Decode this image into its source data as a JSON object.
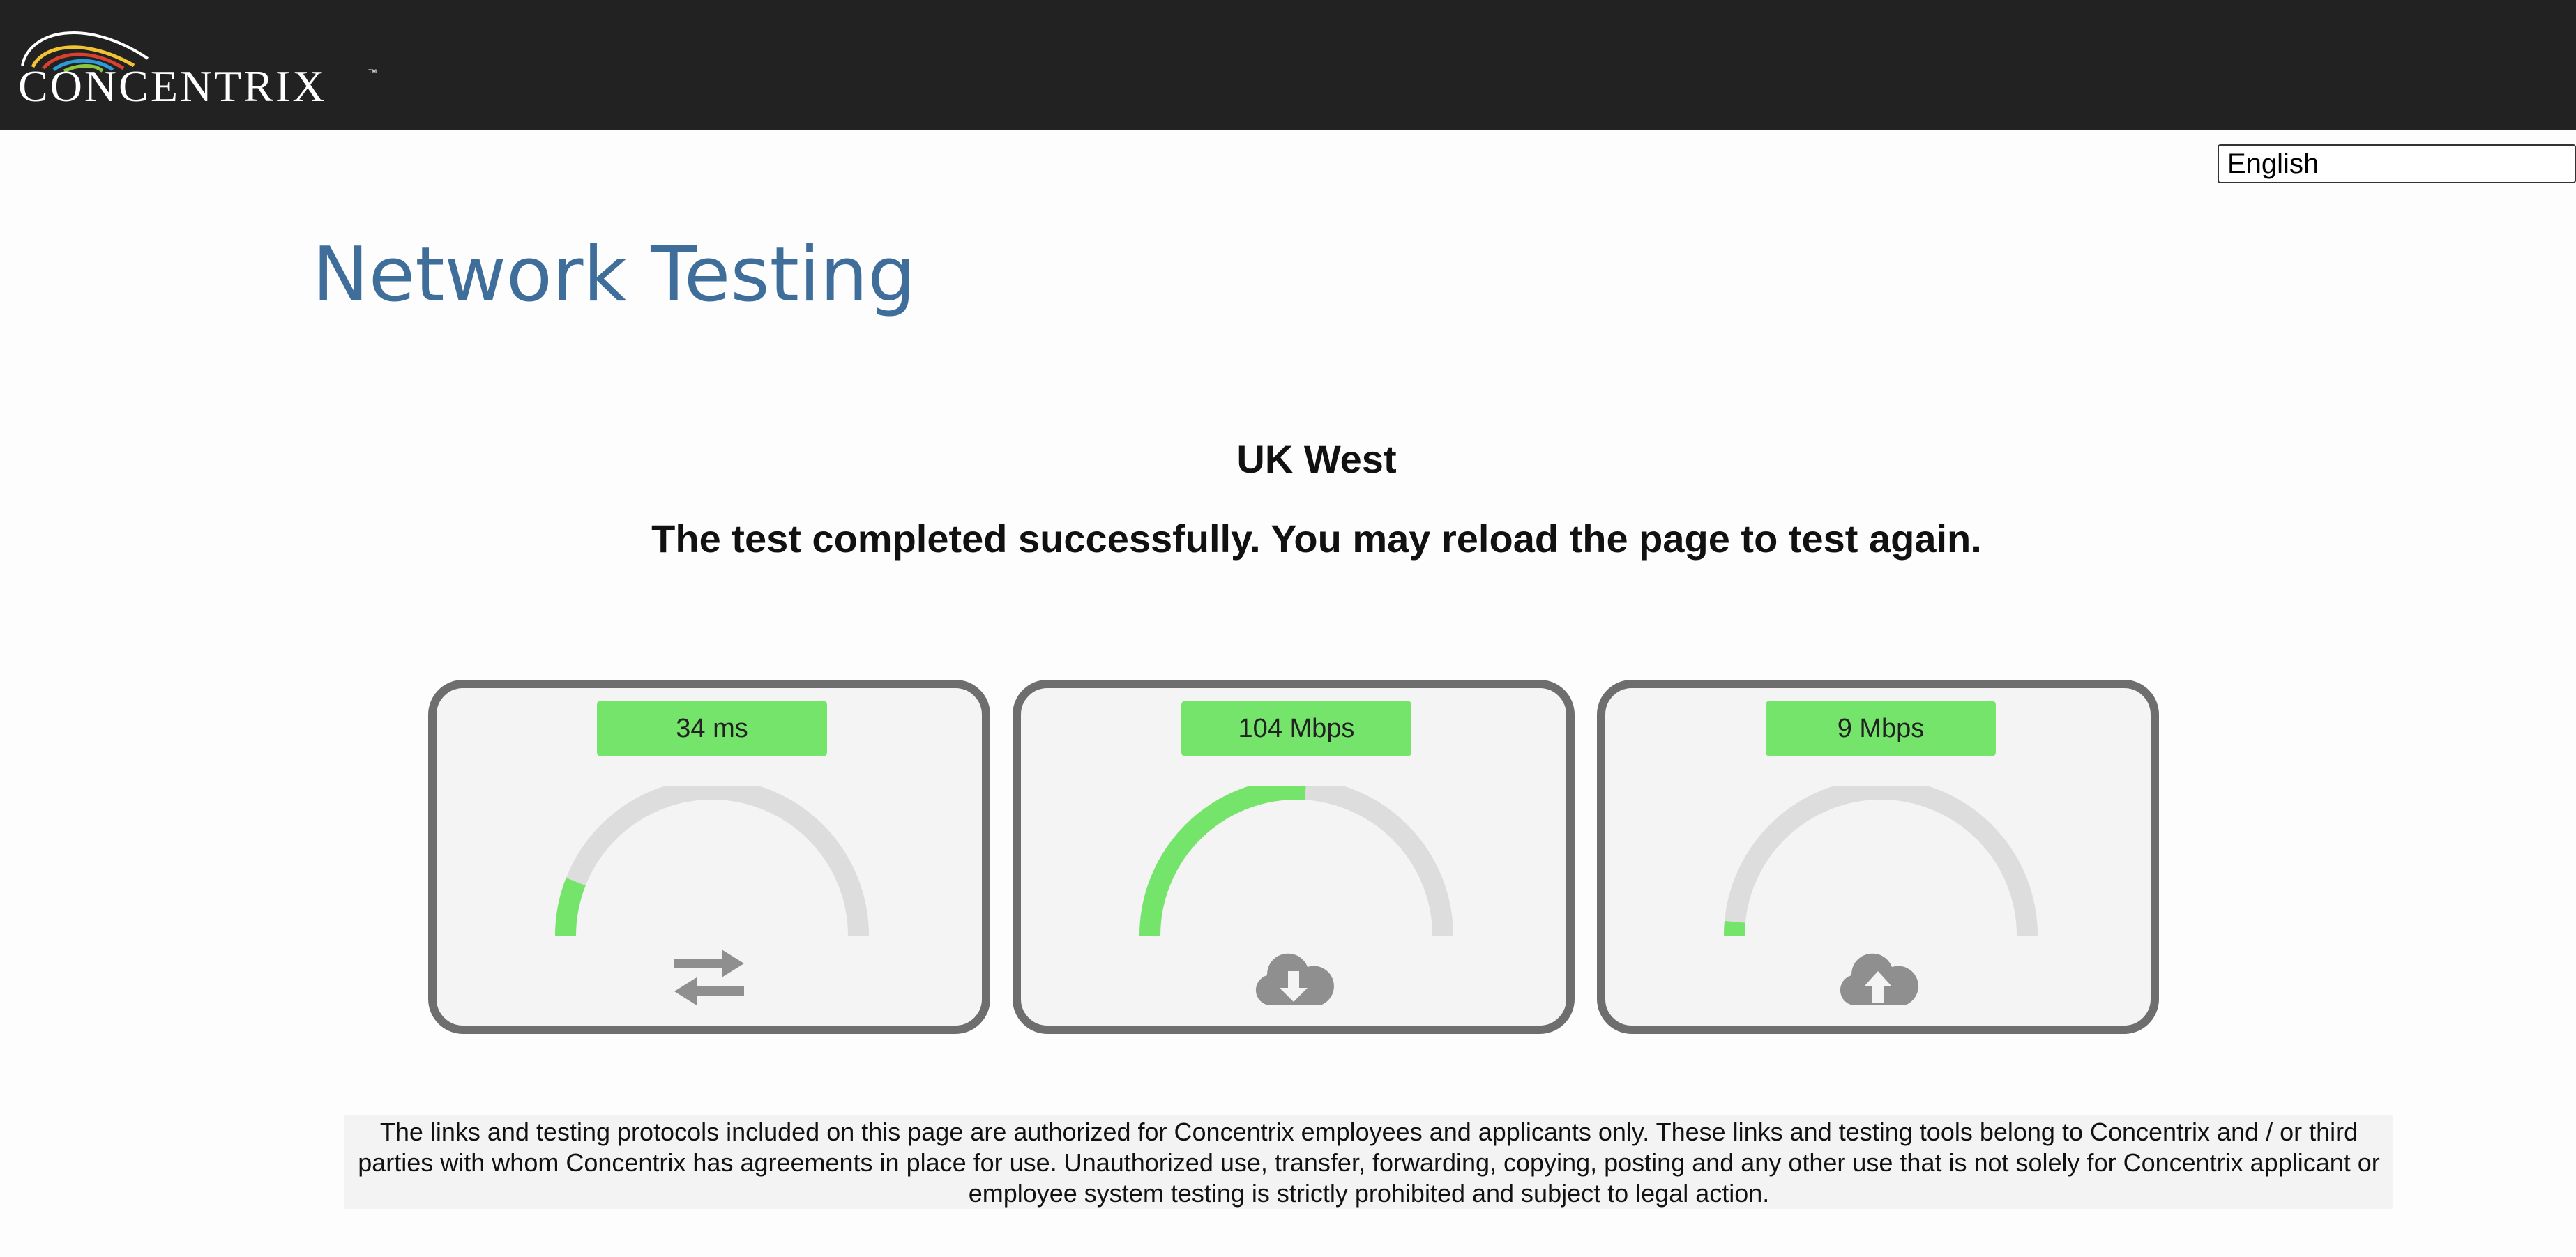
{
  "header": {
    "logo_text": "CONCENTRIX",
    "logo_tm": "™"
  },
  "language": {
    "selected": "English"
  },
  "page": {
    "title": "Network Testing",
    "region": "UK West",
    "status": "The test completed successfully. You may reload the page to test again."
  },
  "cards": [
    {
      "value_label": "34 ms",
      "gauge_fraction": 0.12,
      "icon": "transfer-arrows-icon"
    },
    {
      "value_label": "104 Mbps",
      "gauge_fraction": 0.52,
      "icon": "cloud-download-icon"
    },
    {
      "value_label": "9 Mbps",
      "gauge_fraction": 0.03,
      "icon": "cloud-upload-icon"
    }
  ],
  "colors": {
    "header_bg": "#222222",
    "title": "#3f6e9b",
    "gauge_fill": "#74e56a",
    "gauge_track": "#dddddd",
    "card_border": "#6e6e6e",
    "icon": "#8f8f8f"
  },
  "disclaimer": "The links and testing protocols included on this page are authorized for Concentrix employees and applicants only. These links and testing tools belong to Concentrix and / or third parties with whom Concentrix has agreements in place for use. Unauthorized use, transfer, forwarding, copying, posting and any other use that is not solely for Concentrix applicant or employee system testing is strictly prohibited and subject to legal action."
}
